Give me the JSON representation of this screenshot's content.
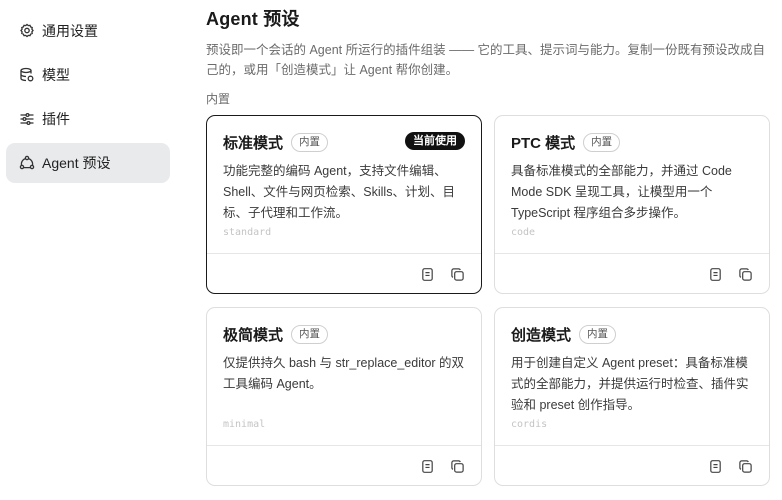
{
  "sidebar": {
    "items": [
      {
        "label": "通用设置",
        "icon": "gear-icon"
      },
      {
        "label": "模型",
        "icon": "database-icon"
      },
      {
        "label": "插件",
        "icon": "sliders-icon"
      },
      {
        "label": "Agent 预设",
        "icon": "agent-cycle-icon",
        "active": true
      }
    ]
  },
  "main": {
    "title": "Agent 预设",
    "description": "预设即一个会话的 Agent 所运行的插件组装 —— 它的工具、提示词与能力。复制一份既有预设改成自己的，或用「创造模式」让 Agent 帮你创建。",
    "section_label": "内置",
    "cards": [
      {
        "name": "标准模式",
        "badge": "内置",
        "current": "当前使用",
        "desc": "功能完整的编码 Agent，支持文件编辑、Shell、文件与网页检索、Skills、计划、目标、子代理和工作流。",
        "code": "standard"
      },
      {
        "name": "PTC 模式",
        "badge": "内置",
        "desc": "具备标准模式的全部能力，并通过 Code Mode SDK 呈现工具，让模型用一个 TypeScript 程序组合多步操作。",
        "code": "code"
      },
      {
        "name": "极简模式",
        "badge": "内置",
        "desc": "仅提供持久 bash 与 str_replace_editor 的双工具编码 Agent。",
        "code": "minimal"
      },
      {
        "name": "创造模式",
        "badge": "内置",
        "desc": "用于创建自定义 Agent preset：具备标准模式的全部能力，并提供运行时检查、插件实验和 preset 创作指导。",
        "code": "cordis"
      }
    ]
  }
}
